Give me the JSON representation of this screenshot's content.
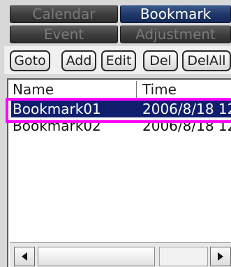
{
  "tabs": {
    "calendar": "Calendar",
    "bookmark": "Bookmark",
    "event": "Event",
    "adjustment": "Adjustment"
  },
  "toolbar": {
    "goto_label": "Goto",
    "add_label": "Add",
    "edit_label": "Edit",
    "del_label": "Del",
    "delall_label": "DelAll"
  },
  "list": {
    "headers": {
      "name": "Name",
      "time": "Time"
    },
    "rows": [
      {
        "name": "Bookmark01",
        "time": "2006/8/18 12",
        "selected": true
      },
      {
        "name": "Bookmark02",
        "time": "2006/8/18 12",
        "selected": false
      }
    ]
  },
  "scrollbar": {
    "left_icon": "arrow-left-icon",
    "right_icon": "arrow-right-icon"
  },
  "colors": {
    "active_tab": "#1e3768",
    "selection": "#0f1f6e",
    "highlight_marker": "#ff00ff"
  }
}
